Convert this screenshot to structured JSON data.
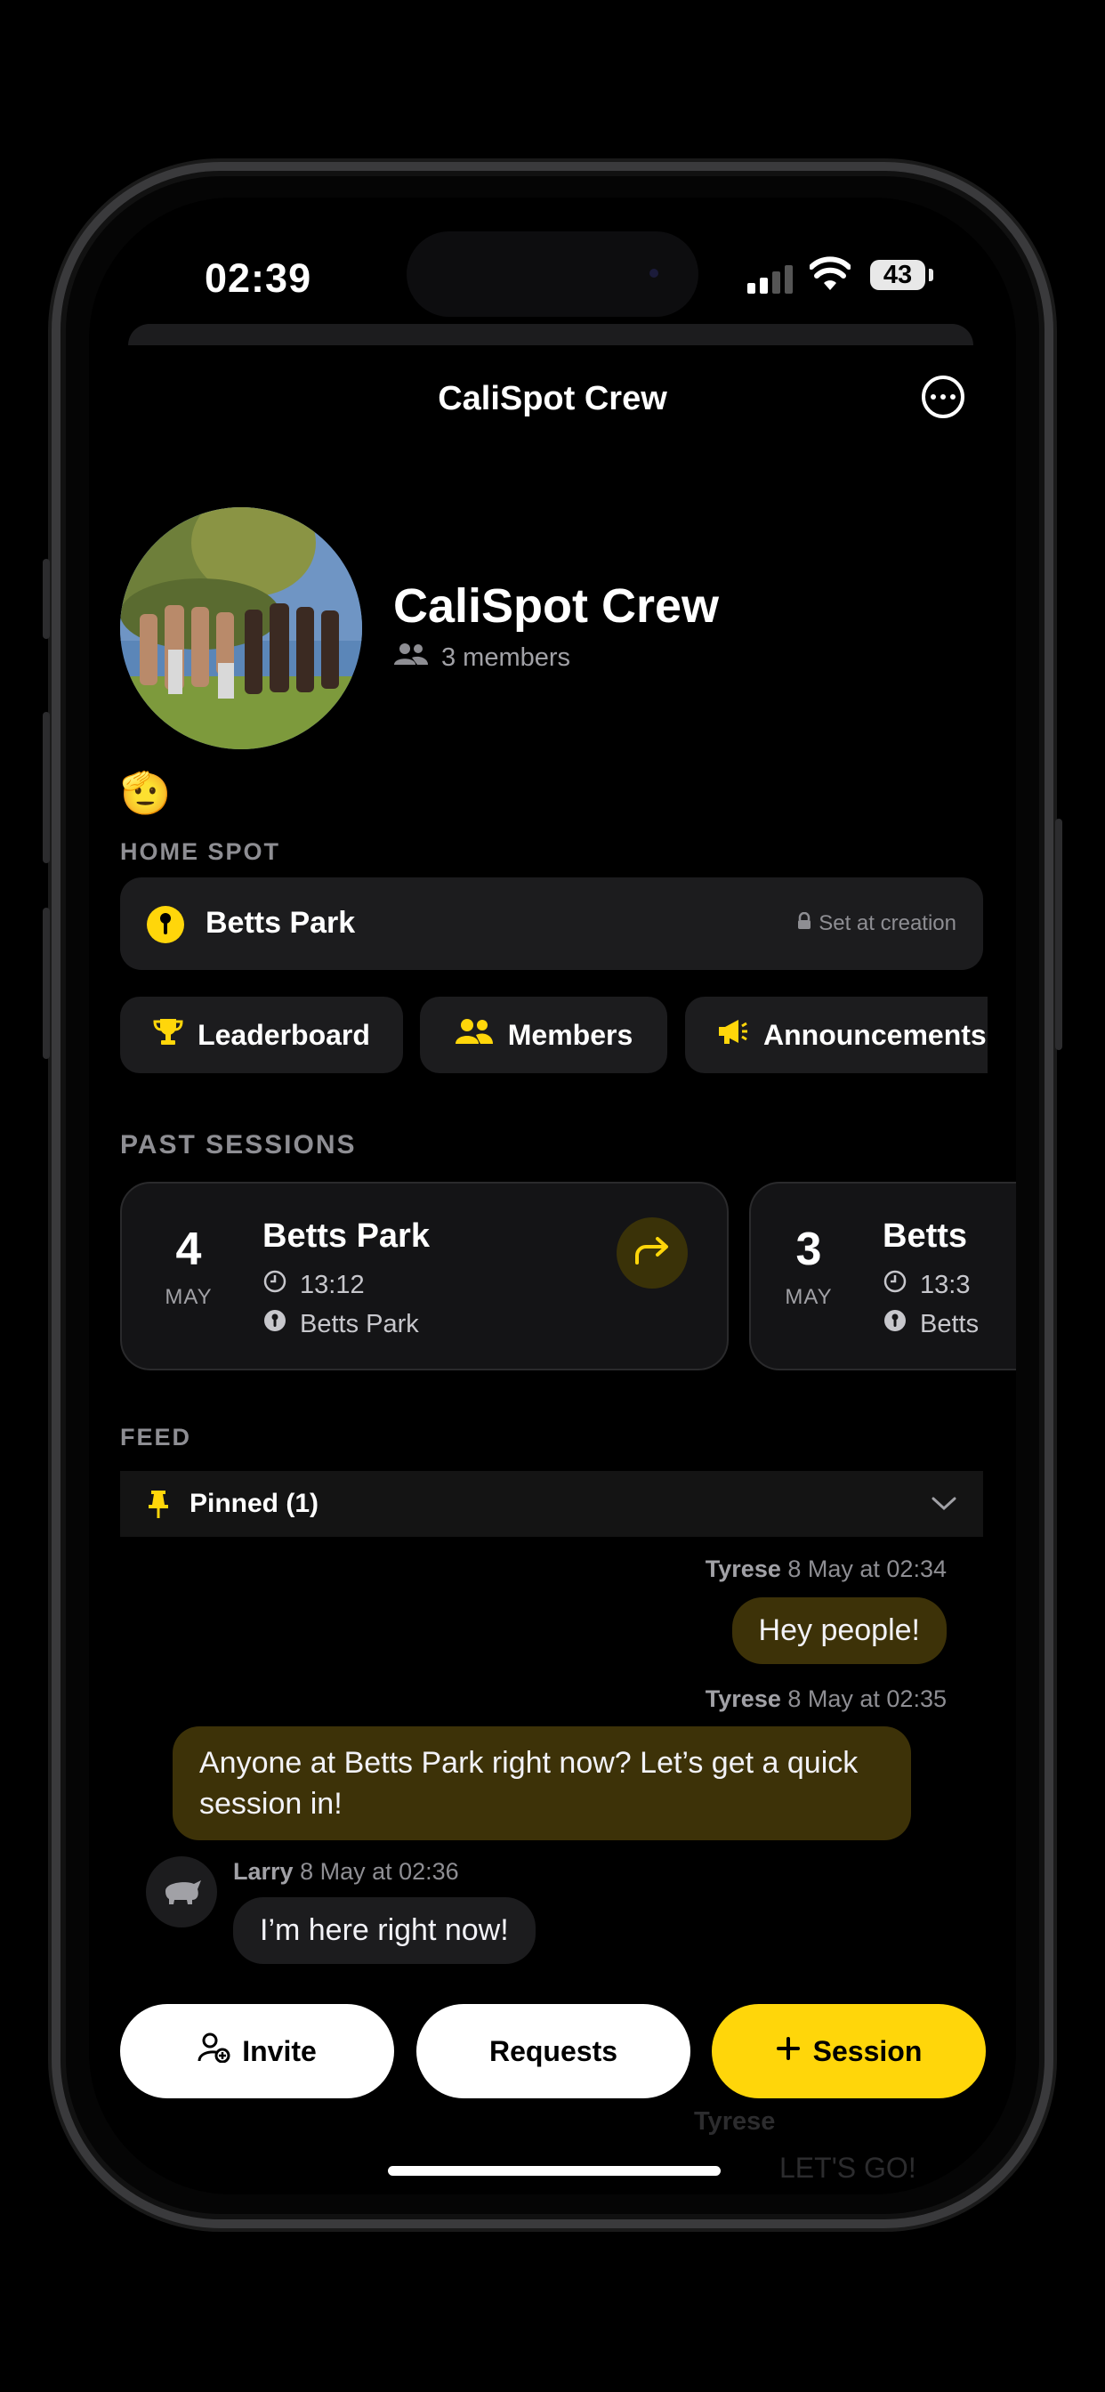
{
  "status_bar": {
    "time": "02:39",
    "battery": "43"
  },
  "nav": {
    "title": "CaliSpot Crew"
  },
  "group": {
    "name": "CaliSpot Crew",
    "members": "3 members",
    "emoji": "🫡"
  },
  "home_spot": {
    "label": "HOME SPOT",
    "name": "Betts Park",
    "note": "Set at creation"
  },
  "chips": [
    {
      "label": "Leaderboard",
      "icon": "trophy-icon"
    },
    {
      "label": "Members",
      "icon": "people-icon"
    },
    {
      "label": "Announcements",
      "icon": "megaphone-icon"
    }
  ],
  "past_sessions": {
    "label": "PAST SESSIONS",
    "items": [
      {
        "day": "4",
        "month": "MAY",
        "title": "Betts Park",
        "time": "13:12",
        "place": "Betts Park"
      },
      {
        "day": "3",
        "month": "MAY",
        "title": "Betts",
        "time": "13:3",
        "place": "Betts"
      }
    ]
  },
  "feed": {
    "label": "FEED",
    "pinned": "Pinned (1)",
    "messages": [
      {
        "author": "Tyrese",
        "time": "8 May at 02:34",
        "text": "Hey people!"
      },
      {
        "author": "Tyrese",
        "time": "8 May at 02:35",
        "text": "Anyone at Betts Park right now? Let’s get a quick session in!"
      },
      {
        "author": "Larry",
        "time": "8 May at 02:36",
        "text": "I’m here right now!"
      }
    ],
    "faded_author": "Tyrese",
    "faded_text": "LET'S GO!"
  },
  "actions": {
    "invite": "Invite",
    "requests": "Requests",
    "session": "Session"
  },
  "colors": {
    "accent": "#ffd60a",
    "card": "#1c1c1e",
    "bubble_mine": "#3d3208"
  }
}
